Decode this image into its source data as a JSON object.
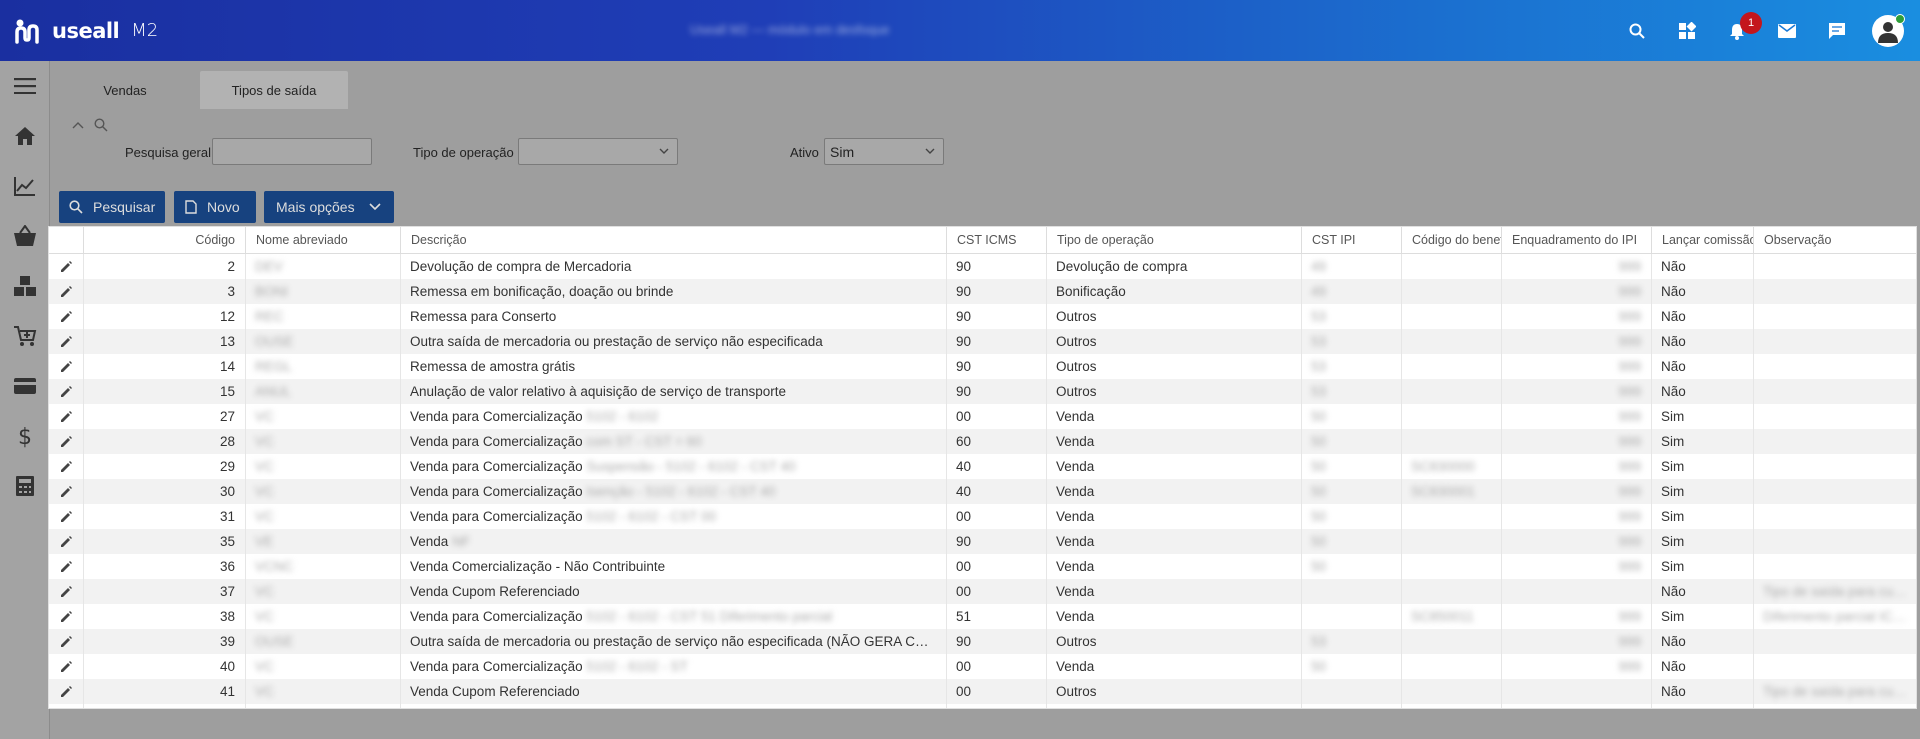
{
  "app": {
    "logo_text": "useall",
    "logo_suffix": "M2",
    "window_title": "Useall M2 — módulo em desfoque"
  },
  "header": {
    "notification_count": "1"
  },
  "tabs": [
    {
      "label": "Vendas"
    },
    {
      "label": "Tipos de saída"
    }
  ],
  "filters": {
    "general_search_label": "Pesquisa geral",
    "general_search_value": "",
    "operation_type_label": "Tipo de operação",
    "operation_type_value": "",
    "active_label": "Ativo",
    "active_value": "Sim"
  },
  "toolbar": {
    "search_label": "Pesquisar",
    "new_label": "Novo",
    "more_label": "Mais opções"
  },
  "table": {
    "columns": [
      "Código",
      "Nome abreviado",
      "Descrição",
      "CST ICMS",
      "Tipo de operação",
      "CST IPI",
      "Código do benef",
      "Enquadramento do IPI",
      "Lançar comissão",
      "Observação"
    ],
    "rows": [
      {
        "codigo": "2",
        "nome": "DEV",
        "descricao": "Devolução de compra de Mercadoria",
        "desc_extra": "",
        "cst_icms": "90",
        "tipo": "Devolução de compra",
        "cst_ipi": "49",
        "cod_benef": "",
        "enq_ipi": "999",
        "comissao": "Não",
        "obs": ""
      },
      {
        "codigo": "3",
        "nome": "BONI",
        "descricao": "Remessa em bonificação, doação ou brinde",
        "desc_extra": "",
        "cst_icms": "90",
        "tipo": "Bonificação",
        "cst_ipi": "49",
        "cod_benef": "",
        "enq_ipi": "999",
        "comissao": "Não",
        "obs": ""
      },
      {
        "codigo": "12",
        "nome": "REC",
        "descricao": "Remessa para Conserto",
        "desc_extra": "",
        "cst_icms": "90",
        "tipo": "Outros",
        "cst_ipi": "53",
        "cod_benef": "",
        "enq_ipi": "999",
        "comissao": "Não",
        "obs": ""
      },
      {
        "codigo": "13",
        "nome": "OUSE",
        "descricao": "Outra saída de mercadoria ou prestação de serviço não especificada",
        "desc_extra": "",
        "cst_icms": "90",
        "tipo": "Outros",
        "cst_ipi": "53",
        "cod_benef": "",
        "enq_ipi": "999",
        "comissao": "Não",
        "obs": ""
      },
      {
        "codigo": "14",
        "nome": "REGL",
        "descricao": "Remessa de amostra grátis",
        "desc_extra": "",
        "cst_icms": "90",
        "tipo": "Outros",
        "cst_ipi": "53",
        "cod_benef": "",
        "enq_ipi": "999",
        "comissao": "Não",
        "obs": ""
      },
      {
        "codigo": "15",
        "nome": "ANUL",
        "descricao": "Anulação de valor relativo à aquisição de serviço de transporte",
        "desc_extra": "",
        "cst_icms": "90",
        "tipo": "Outros",
        "cst_ipi": "53",
        "cod_benef": "",
        "enq_ipi": "999",
        "comissao": "Não",
        "obs": ""
      },
      {
        "codigo": "27",
        "nome": "VC",
        "descricao": "Venda para Comercialização",
        "desc_extra": "5102 - 6102",
        "cst_icms": "00",
        "tipo": "Venda",
        "cst_ipi": "50",
        "cod_benef": "",
        "enq_ipi": "999",
        "comissao": "Sim",
        "obs": ""
      },
      {
        "codigo": "28",
        "nome": "VC",
        "descricao": "Venda para Comercialização",
        "desc_extra": "com ST - CST = 60",
        "cst_icms": "60",
        "tipo": "Venda",
        "cst_ipi": "50",
        "cod_benef": "",
        "enq_ipi": "999",
        "comissao": "Sim",
        "obs": ""
      },
      {
        "codigo": "29",
        "nome": "VC",
        "descricao": "Venda para Comercialização",
        "desc_extra": "Suspensão - 5102 - 6102 - CST 40",
        "cst_icms": "40",
        "tipo": "Venda",
        "cst_ipi": "50",
        "cod_benef": "SC830000",
        "enq_ipi": "999",
        "comissao": "Sim",
        "obs": ""
      },
      {
        "codigo": "30",
        "nome": "VC",
        "descricao": "Venda para Comercialização",
        "desc_extra": "Isenção - 5102 - 6102 - CST 40",
        "cst_icms": "40",
        "tipo": "Venda",
        "cst_ipi": "50",
        "cod_benef": "SC830001",
        "enq_ipi": "999",
        "comissao": "Sim",
        "obs": ""
      },
      {
        "codigo": "31",
        "nome": "VC",
        "descricao": "Venda para Comercialização",
        "desc_extra": "5102 - 6102 - CST 00",
        "cst_icms": "00",
        "tipo": "Venda",
        "cst_ipi": "50",
        "cod_benef": "",
        "enq_ipi": "999",
        "comissao": "Sim",
        "obs": ""
      },
      {
        "codigo": "35",
        "nome": "VE",
        "descricao": "Venda",
        "desc_extra": "NF",
        "cst_icms": "90",
        "tipo": "Venda",
        "cst_ipi": "50",
        "cod_benef": "",
        "enq_ipi": "999",
        "comissao": "Sim",
        "obs": ""
      },
      {
        "codigo": "36",
        "nome": "VCNC",
        "descricao": "Venda Comercialização - Não Contribuinte",
        "desc_extra": "",
        "cst_icms": "00",
        "tipo": "Venda",
        "cst_ipi": "50",
        "cod_benef": "",
        "enq_ipi": "999",
        "comissao": "Sim",
        "obs": ""
      },
      {
        "codigo": "37",
        "nome": "VC",
        "descricao": "Venda Cupom Referenciado",
        "desc_extra": "",
        "cst_icms": "00",
        "tipo": "Venda",
        "cst_ipi": "",
        "cod_benef": "",
        "enq_ipi": "",
        "comissao": "Não",
        "obs": "Tipo de saída para cupom referenciado"
      },
      {
        "codigo": "38",
        "nome": "VC",
        "descricao": "Venda para Comercialização",
        "desc_extra": "5102 - 6102 - CST 51 Diferimento parcial",
        "cst_icms": "51",
        "tipo": "Venda",
        "cst_ipi": "",
        "cod_benef": "SC850011",
        "enq_ipi": "999",
        "comissao": "Sim",
        "obs": "Diferimento parcial ICMS"
      },
      {
        "codigo": "39",
        "nome": "OUSE",
        "descricao": "Outra saída de mercadoria ou prestação de serviço não especificada (NÃO GERA CONTÁBIL)",
        "desc_extra": "",
        "cst_icms": "90",
        "tipo": "Outros",
        "cst_ipi": "53",
        "cod_benef": "",
        "enq_ipi": "999",
        "comissao": "Não",
        "obs": ""
      },
      {
        "codigo": "40",
        "nome": "VC",
        "descricao": "Venda para Comercialização",
        "desc_extra": "5102 - 6102 - ST",
        "cst_icms": "00",
        "tipo": "Venda",
        "cst_ipi": "50",
        "cod_benef": "",
        "enq_ipi": "999",
        "comissao": "Não",
        "obs": ""
      },
      {
        "codigo": "41",
        "nome": "VC",
        "descricao": "Venda Cupom Referenciado",
        "desc_extra": "",
        "cst_icms": "00",
        "tipo": "Outros",
        "cst_ipi": "",
        "cod_benef": "",
        "enq_ipi": "",
        "comissao": "Não",
        "obs": "Tipo de saída para cupom referenciado"
      }
    ]
  }
}
